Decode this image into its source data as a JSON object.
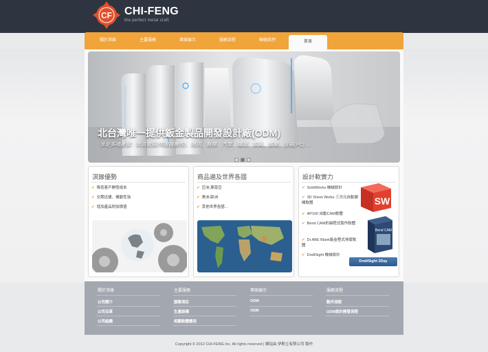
{
  "header": {
    "logo_letters": "CF",
    "brand": "CHI-FENG",
    "tagline": "the perfect metal craft"
  },
  "nav": {
    "items": [
      {
        "label": "關於淇錄"
      },
      {
        "label": "主要服務"
      },
      {
        "label": "專案展示"
      },
      {
        "label": "服務流程"
      },
      {
        "label": "聯絡我們"
      },
      {
        "label": "首頁"
      }
    ],
    "active": "首頁"
  },
  "banner": {
    "title": "北台灣唯一提供鈑金製品開發設計廠(ODM)",
    "subtitle": "涉足多項產業：資訊電腦(伺服器機殼)、通訊、醫療、汽車、鐵道、家具，娛樂，音箱(PC) …"
  },
  "panels": [
    {
      "title": "淇錄優勢",
      "items": [
        "降低客戶開發成本",
        "交期迅捷、機動性強",
        "增加產品附加價值"
      ]
    },
    {
      "title": "商品遍及世界各國",
      "items": [
        "亞洲,東南亞",
        "美洲,歐洲",
        "其他世界各國..."
      ]
    },
    {
      "title": "設計軟實力",
      "items": [
        "SolidWorks 機械設計",
        "3D Sheet Works 三次元自動展開軟體",
        "AP100 自動CAM軟體",
        "Bend CAM折曲程式製作軟體",
        "Dr.ABE Blank鈑金程式排版軟體",
        "DraftSight 機械設計"
      ],
      "badge_sw": "SW",
      "badge_bendcam": "Bend CAM",
      "badge_draftsight": "DraftSight 2Day"
    }
  ],
  "footer": {
    "columns": [
      {
        "heading": "關於淇錄",
        "links": [
          "公司簡介",
          "公司沿革",
          "公司組織"
        ]
      },
      {
        "heading": "主要服務",
        "links": [
          "服務項目",
          "生產設備",
          "相關軟體應用"
        ]
      },
      {
        "heading": "專案展示",
        "links": [
          "ODM",
          "OEM"
        ]
      },
      {
        "heading": "服務流程",
        "links": [
          "製作流程",
          "ODM設計開發流程"
        ]
      }
    ],
    "copyright": "Copyright © 2012 CHI-FENG Inc. All rights reserved | 網站由 伊斯立有限公司 製作"
  },
  "colors": {
    "accent": "#f0a43a",
    "topbar": "#2e3540",
    "footer": "#a3a8b0",
    "logo": "#e0502c"
  }
}
